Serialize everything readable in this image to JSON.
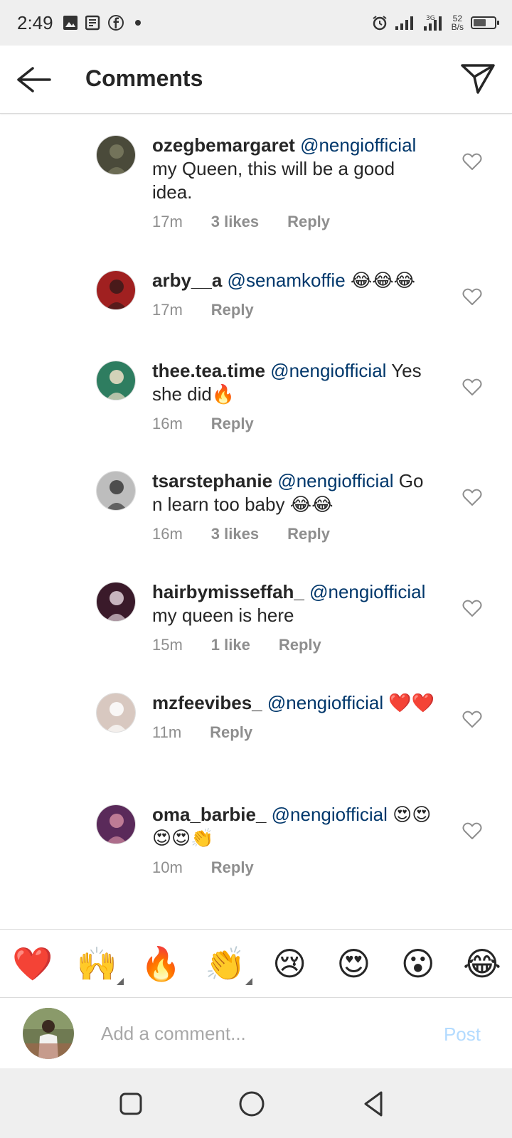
{
  "status_bar": {
    "time": "2:49",
    "net_speed_value": "52",
    "net_speed_unit": "B/s",
    "battery_level": 0.6
  },
  "header": {
    "title": "Comments"
  },
  "comments": [
    {
      "username": "ozegbemargaret",
      "mention": "@nengiofficial",
      "text": " my Queen, this will be a good idea.",
      "time": "17m",
      "likes": "3 likes",
      "reply": "Reply"
    },
    {
      "username": "arby__a",
      "mention": "@senamkoffie",
      "text": " 😂😂😂",
      "time": "17m",
      "likes": "",
      "reply": "Reply"
    },
    {
      "username": "thee.tea.time",
      "mention": "@nengiofficial",
      "text": " Yes she did🔥",
      "time": "16m",
      "likes": "",
      "reply": "Reply"
    },
    {
      "username": "tsarstephanie",
      "mention": "@nengiofficial",
      "text": " Go n learn too baby 😂😂",
      "time": "16m",
      "likes": "3 likes",
      "reply": "Reply"
    },
    {
      "username": "hairbymisseffah_",
      "mention": "@nengiofficial",
      "text": " my queen is here",
      "time": "15m",
      "likes": "1 like",
      "reply": "Reply"
    },
    {
      "username": "mzfeevibes_",
      "mention": "@nengiofficial",
      "text": " ❤️❤️",
      "time": "11m",
      "likes": "",
      "reply": "Reply"
    },
    {
      "username": "oma_barbie_",
      "mention": "@nengiofficial",
      "text": " 😍😍😍😍👏",
      "time": "10m",
      "likes": "",
      "reply": "Reply"
    }
  ],
  "emoji_bar": [
    "❤️",
    "🙌",
    "🔥",
    "👏",
    "😢",
    "😍",
    "😮",
    "😂"
  ],
  "add_comment": {
    "placeholder": "Add a comment...",
    "post_label": "Post"
  },
  "colors": {
    "mention": "#00376b",
    "meta": "#8e8e8e",
    "post_disabled": "#b3dbff",
    "system_bar": "#efefef"
  }
}
